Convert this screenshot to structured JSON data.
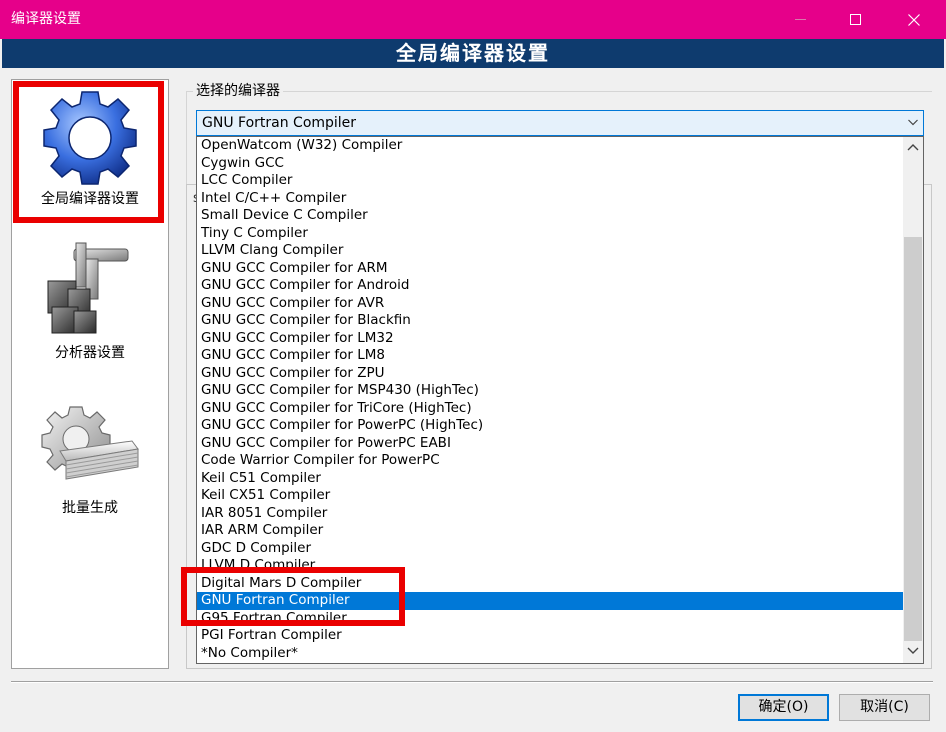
{
  "window": {
    "title": "编译器设置"
  },
  "banner": {
    "title": "全局编译器设置"
  },
  "sidebar": {
    "items": [
      {
        "label": "全局编译器设置",
        "icon": "gear-icon",
        "selected": true
      },
      {
        "label": "分析器设置",
        "icon": "caliper-icon"
      },
      {
        "label": "批量生成",
        "icon": "gear-stack-icon"
      }
    ]
  },
  "compiler_group": {
    "label": "选择的编译器",
    "selected_value": "GNU Fortran Compiler",
    "options": [
      "OpenWatcom (W32) Compiler",
      "Cygwin GCC",
      "LCC Compiler",
      "Intel C/C++ Compiler",
      "Small Device C Compiler",
      "Tiny C Compiler",
      "LLVM Clang Compiler",
      "GNU GCC Compiler for ARM",
      "GNU GCC Compiler for Android",
      "GNU GCC Compiler for AVR",
      "GNU GCC Compiler for Blackfin",
      "GNU GCC Compiler for LM32",
      "GNU GCC Compiler for LM8",
      "GNU GCC Compiler for ZPU",
      "GNU GCC Compiler for MSP430 (HighTec)",
      "GNU GCC Compiler for TriCore (HighTec)",
      "GNU GCC Compiler for PowerPC (HighTec)",
      "GNU GCC Compiler for PowerPC EABI",
      "Code Warrior Compiler for PowerPC",
      "Keil C51 Compiler",
      "Keil CX51 Compiler",
      "IAR 8051 Compiler",
      "IAR ARM Compiler",
      "GDC D Compiler",
      "LLVM D Compiler",
      "Digital Mars D Compiler",
      "GNU Fortran Compiler",
      "G95 Fortran Compiler",
      "PGI Fortran Compiler",
      "*No Compiler*"
    ],
    "selected_index": 26
  },
  "panel_edge_char": "s",
  "buttons": {
    "ok": "确定(O)",
    "cancel": "取消(C)"
  },
  "colors": {
    "titlebar": "#e6008a",
    "banner": "#0e3b6e",
    "selection": "#0078d7",
    "highlight_box": "#ea0000"
  }
}
